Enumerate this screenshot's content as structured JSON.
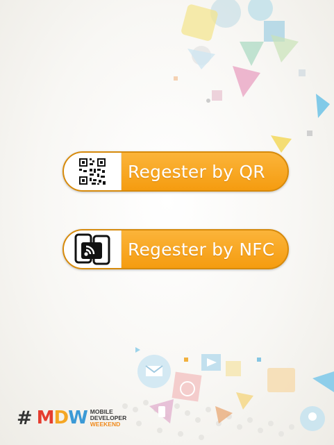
{
  "buttons": [
    {
      "label": "Regester by QR",
      "icon": "qr-code-icon"
    },
    {
      "label": "Regester by NFC",
      "icon": "nfc-phones-icon"
    }
  ],
  "footer": {
    "hash": "#",
    "logo_mark": "MDW",
    "logo_line1": "MOBILE",
    "logo_line2": "DEVELOPER",
    "logo_line3": "WEEKEND"
  },
  "colors": {
    "button_orange": "#f7a21b",
    "button_border": "#d68a0c",
    "accent_blue": "#5fb8e0",
    "accent_pink": "#e35a8c",
    "accent_yellow": "#f2c640"
  }
}
